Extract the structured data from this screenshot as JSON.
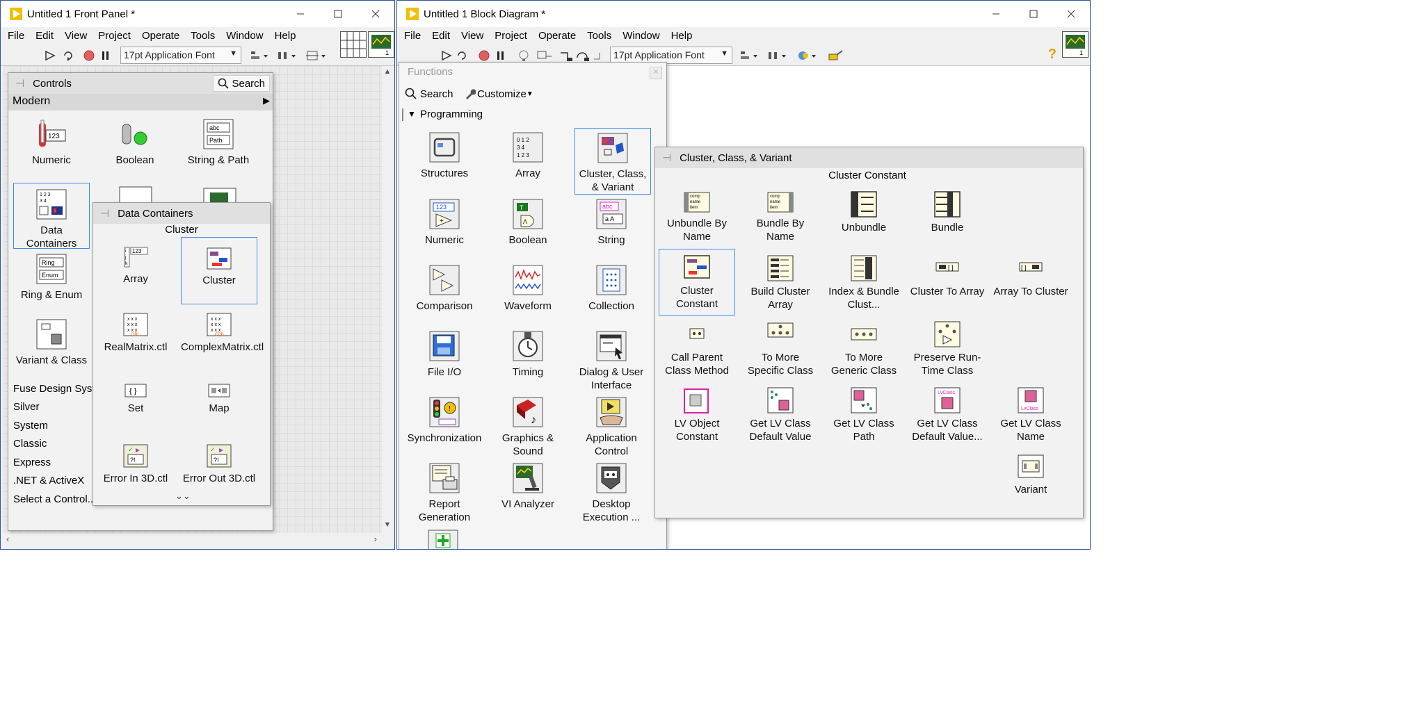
{
  "front_panel": {
    "title": "Untitled 1 Front Panel *",
    "menu": [
      "File",
      "Edit",
      "View",
      "Project",
      "Operate",
      "Tools",
      "Window",
      "Help"
    ],
    "font_select": "17pt Application Font",
    "controls_palette": {
      "title": "Controls",
      "search_label": "Search",
      "category": "Modern",
      "items": [
        {
          "label": "Numeric",
          "icon": "numeric-control-icon"
        },
        {
          "label": "Boolean",
          "icon": "boolean-control-icon"
        },
        {
          "label": "String & Path",
          "icon": "string-path-icon"
        },
        {
          "label": "Data Containers",
          "icon": "data-containers-icon"
        },
        {
          "label": "Ring & Enum",
          "icon": "ring-enum-icon"
        },
        {
          "label": "Variant & Class",
          "icon": "variant-class-icon"
        }
      ],
      "categories": [
        "Fuse Design Syste",
        "Silver",
        "System",
        "Classic",
        "Express",
        ".NET & ActiveX",
        "Select a Control..."
      ]
    },
    "data_containers_palette": {
      "title": "Data Containers",
      "hover_caption": "Cluster",
      "items": [
        {
          "label": "Array",
          "icon": "array-icon"
        },
        {
          "label": "Cluster",
          "icon": "cluster-icon"
        },
        {
          "label": "RealMatrix.ctl",
          "icon": "real-matrix-icon"
        },
        {
          "label": "ComplexMatrix.ctl",
          "icon": "complex-matrix-icon"
        },
        {
          "label": "Set",
          "icon": "set-icon"
        },
        {
          "label": "Map",
          "icon": "map-icon"
        },
        {
          "label": "Error In 3D.ctl",
          "icon": "error-in-icon"
        },
        {
          "label": "Error Out 3D.ctl",
          "icon": "error-out-icon"
        }
      ]
    }
  },
  "block_diagram": {
    "title": "Untitled 1 Block Diagram *",
    "menu": [
      "File",
      "Edit",
      "View",
      "Project",
      "Operate",
      "Tools",
      "Window",
      "Help"
    ],
    "font_select": "17pt Application Font",
    "functions_palette": {
      "title": "Functions",
      "search_label": "Search",
      "customize_label": "Customize",
      "category": "Programming",
      "items": [
        {
          "label": "Structures",
          "icon": "structures-icon"
        },
        {
          "label": "Array",
          "icon": "array-functions-icon"
        },
        {
          "label": "Cluster, Class, & Variant",
          "icon": "cluster-class-variant-icon"
        },
        {
          "label": "Numeric",
          "icon": "numeric-functions-icon"
        },
        {
          "label": "Boolean",
          "icon": "boolean-functions-icon"
        },
        {
          "label": "String",
          "icon": "string-functions-icon"
        },
        {
          "label": "Comparison",
          "icon": "comparison-icon"
        },
        {
          "label": "Waveform",
          "icon": "waveform-icon"
        },
        {
          "label": "Collection",
          "icon": "collection-icon"
        },
        {
          "label": "File I/O",
          "icon": "file-io-icon"
        },
        {
          "label": "Timing",
          "icon": "timing-icon"
        },
        {
          "label": "Dialog & User Interface",
          "icon": "dialog-ui-icon"
        },
        {
          "label": "Synchronization",
          "icon": "synchronization-icon"
        },
        {
          "label": "Graphics & Sound",
          "icon": "graphics-sound-icon"
        },
        {
          "label": "Application Control",
          "icon": "application-control-icon"
        },
        {
          "label": "Report Generation",
          "icon": "report-generation-icon"
        },
        {
          "label": "VI Analyzer",
          "icon": "vi-analyzer-icon"
        },
        {
          "label": "Desktop Execution ...",
          "icon": "desktop-execution-icon"
        }
      ]
    },
    "ccv_palette": {
      "title": "Cluster, Class, & Variant",
      "hover_caption": "Cluster Constant",
      "items": [
        {
          "label": "Unbundle By Name",
          "icon": "unbundle-by-name-icon"
        },
        {
          "label": "Bundle By Name",
          "icon": "bundle-by-name-icon"
        },
        {
          "label": "Unbundle",
          "icon": "unbundle-icon"
        },
        {
          "label": "Bundle",
          "icon": "bundle-icon"
        },
        {
          "label": "Cluster Constant",
          "icon": "cluster-constant-icon"
        },
        {
          "label": "Build Cluster Array",
          "icon": "build-cluster-array-icon"
        },
        {
          "label": "Index & Bundle Clust...",
          "icon": "index-bundle-cluster-icon"
        },
        {
          "label": "Cluster To Array",
          "icon": "cluster-to-array-icon"
        },
        {
          "label": "Array To Cluster",
          "icon": "array-to-cluster-icon"
        },
        {
          "label": "Call Parent Class Method",
          "icon": "call-parent-method-icon"
        },
        {
          "label": "To More Specific Class",
          "icon": "to-more-specific-icon"
        },
        {
          "label": "To More Generic Class",
          "icon": "to-more-generic-icon"
        },
        {
          "label": "Preserve Run-Time Class",
          "icon": "preserve-runtime-icon"
        },
        {
          "label": "LV Object Constant",
          "icon": "lv-object-constant-icon"
        },
        {
          "label": "Get LV Class Default Value",
          "icon": "get-class-default-icon"
        },
        {
          "label": "Get LV Class Path",
          "icon": "get-class-path-icon"
        },
        {
          "label": "Get LV Class Default Value...",
          "icon": "get-class-default-by-name-icon"
        },
        {
          "label": "Get LV Class Name",
          "icon": "get-class-name-icon"
        },
        {
          "label": "Variant",
          "icon": "variant-icon"
        }
      ]
    }
  },
  "colors": {
    "selection_border": "#3a8ee6",
    "window_border": "#2b5797",
    "labview_yellow": "#f0c000"
  }
}
